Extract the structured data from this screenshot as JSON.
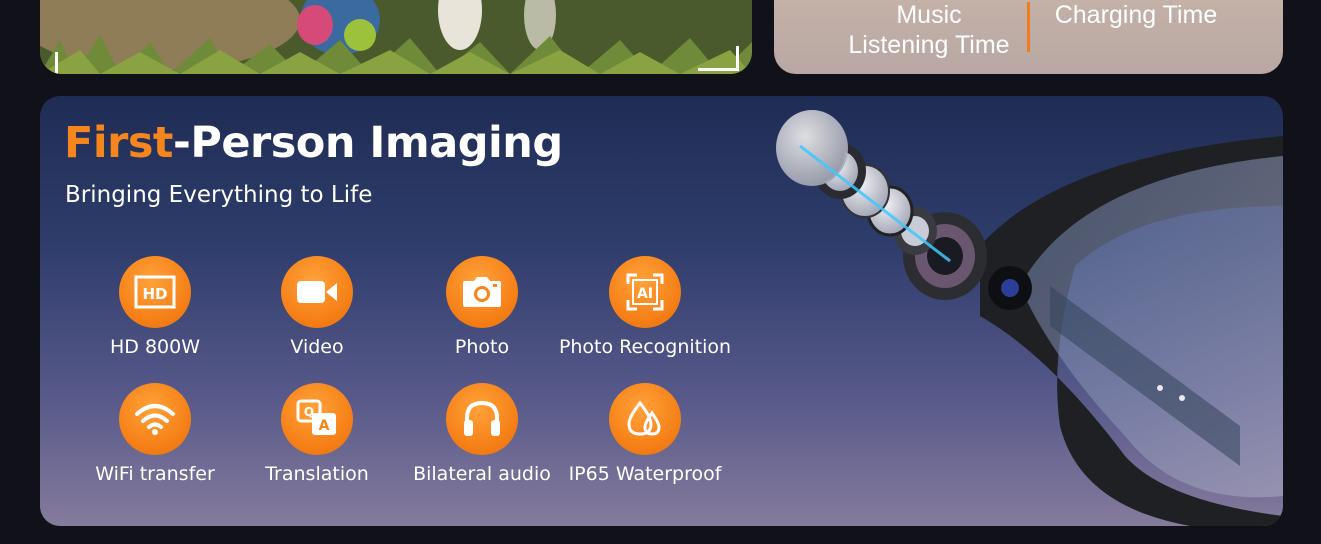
{
  "top": {
    "spec_left": "Music\nListening Time",
    "spec_right": "Charging Time"
  },
  "panel": {
    "title_accent": "First",
    "title_rest": "-Person Imaging",
    "subtitle": "Bringing Everything to Life"
  },
  "features": [
    {
      "label": "HD 800W",
      "icon": "hd-icon"
    },
    {
      "label": "Video",
      "icon": "video-camera-icon"
    },
    {
      "label": "Photo",
      "icon": "camera-icon"
    },
    {
      "label": "Photo Recognition",
      "icon": "ai-scan-icon"
    },
    {
      "label": "WiFi transfer",
      "icon": "wifi-icon"
    },
    {
      "label": "Translation",
      "icon": "translation-icon"
    },
    {
      "label": "Bilateral audio",
      "icon": "headphones-icon"
    },
    {
      "label": "IP65 Waterproof",
      "icon": "water-drops-icon"
    }
  ],
  "colors": {
    "accent": "#f5861e",
    "panel_top": "#1f2c54",
    "panel_bottom": "#857b9c",
    "spec_card": "#c7b4a9"
  }
}
